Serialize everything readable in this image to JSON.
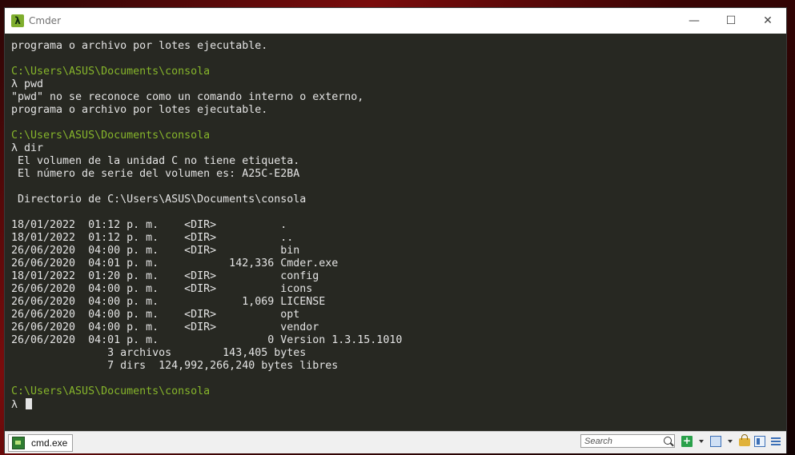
{
  "window": {
    "title": "Cmder",
    "app_icon_glyph": "λ",
    "controls": {
      "minimize": "—",
      "maximize": "☐",
      "close": "✕"
    }
  },
  "terminal": {
    "lines": [
      "programa o archivo por lotes ejecutable.",
      "",
      "C:\\Users\\ASUS\\Documents\\consola",
      "λ pwd",
      "\"pwd\" no se reconoce como un comando interno o externo,",
      "programa o archivo por lotes ejecutable.",
      "",
      "C:\\Users\\ASUS\\Documents\\consola",
      "λ dir",
      " El volumen de la unidad C no tiene etiqueta.",
      " El número de serie del volumen es: A25C-E2BA",
      "",
      " Directorio de C:\\Users\\ASUS\\Documents\\consola",
      "",
      "18/01/2022  01:12 p. m.    <DIR>          .",
      "18/01/2022  01:12 p. m.    <DIR>          ..",
      "26/06/2020  04:00 p. m.    <DIR>          bin",
      "26/06/2020  04:01 p. m.           142,336 Cmder.exe",
      "18/01/2022  01:20 p. m.    <DIR>          config",
      "26/06/2020  04:00 p. m.    <DIR>          icons",
      "26/06/2020  04:00 p. m.             1,069 LICENSE",
      "26/06/2020  04:00 p. m.    <DIR>          opt",
      "26/06/2020  04:00 p. m.    <DIR>          vendor",
      "26/06/2020  04:01 p. m.                 0 Version 1.3.15.1010",
      "               3 archivos        143,405 bytes",
      "               7 dirs  124,992,266,240 bytes libres",
      "",
      "C:\\Users\\ASUS\\Documents\\consola",
      "λ "
    ],
    "path_color": "#86b52b",
    "text_color": "#e4e4e4",
    "background": "#272822"
  },
  "statusbar": {
    "tab_label": "cmd.exe",
    "search_placeholder": "Search"
  },
  "icons": [
    "cmder-lambda-icon",
    "minimize-icon",
    "maximize-icon",
    "close-icon",
    "console-tab-icon",
    "search-icon",
    "new-console-icon",
    "split-icon",
    "lock-icon",
    "layout-icon",
    "menu-icon"
  ]
}
